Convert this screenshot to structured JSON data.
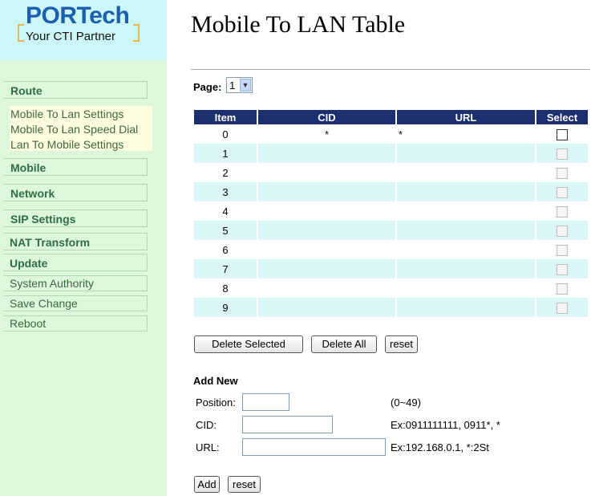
{
  "logo": {
    "word": "PORTech",
    "tagline": "Your CTI Partner"
  },
  "sidebar": {
    "route_label": "Route",
    "route_items": [
      "Mobile To Lan Settings",
      "Mobile To Lan Speed Dial",
      "Lan To Mobile Settings"
    ],
    "sections": [
      "Mobile",
      "Network",
      "SIP Settings",
      "NAT Transform",
      "Update"
    ],
    "links": [
      "System Authority",
      "Save Change",
      "Reboot"
    ]
  },
  "page": {
    "title": "Mobile To LAN Table",
    "page_label": "Page:",
    "page_value": "1"
  },
  "table": {
    "headers": [
      "Item",
      "CID",
      "URL",
      "Select"
    ],
    "rows": [
      {
        "item": "0",
        "cid": "*",
        "url": "*"
      },
      {
        "item": "1",
        "cid": "",
        "url": ""
      },
      {
        "item": "2",
        "cid": "",
        "url": ""
      },
      {
        "item": "3",
        "cid": "",
        "url": ""
      },
      {
        "item": "4",
        "cid": "",
        "url": ""
      },
      {
        "item": "5",
        "cid": "",
        "url": ""
      },
      {
        "item": "6",
        "cid": "",
        "url": ""
      },
      {
        "item": "7",
        "cid": "",
        "url": ""
      },
      {
        "item": "8",
        "cid": "",
        "url": ""
      },
      {
        "item": "9",
        "cid": "",
        "url": ""
      }
    ]
  },
  "actions": {
    "delete_selected": "Delete Selected",
    "delete_all": "Delete All",
    "reset": "reset"
  },
  "add_new": {
    "title": "Add New",
    "position_label": "Position:",
    "position_value": "",
    "position_hint": "(0~49)",
    "cid_label": "CID:",
    "cid_value": "",
    "cid_hint": "Ex:0911111111,  0911*,  *",
    "url_label": "URL:",
    "url_value": "",
    "url_hint": "Ex:192.168.0.1,  *:2St",
    "add": "Add",
    "reset": "reset"
  },
  "colors": {
    "sidebar_bg": "#ddf7dd",
    "logo_bg": "#ccf7f7",
    "header_bg": "#1c2f6e",
    "row_alt": "#dbf6f6",
    "brand_blue": "#1b5fad"
  }
}
